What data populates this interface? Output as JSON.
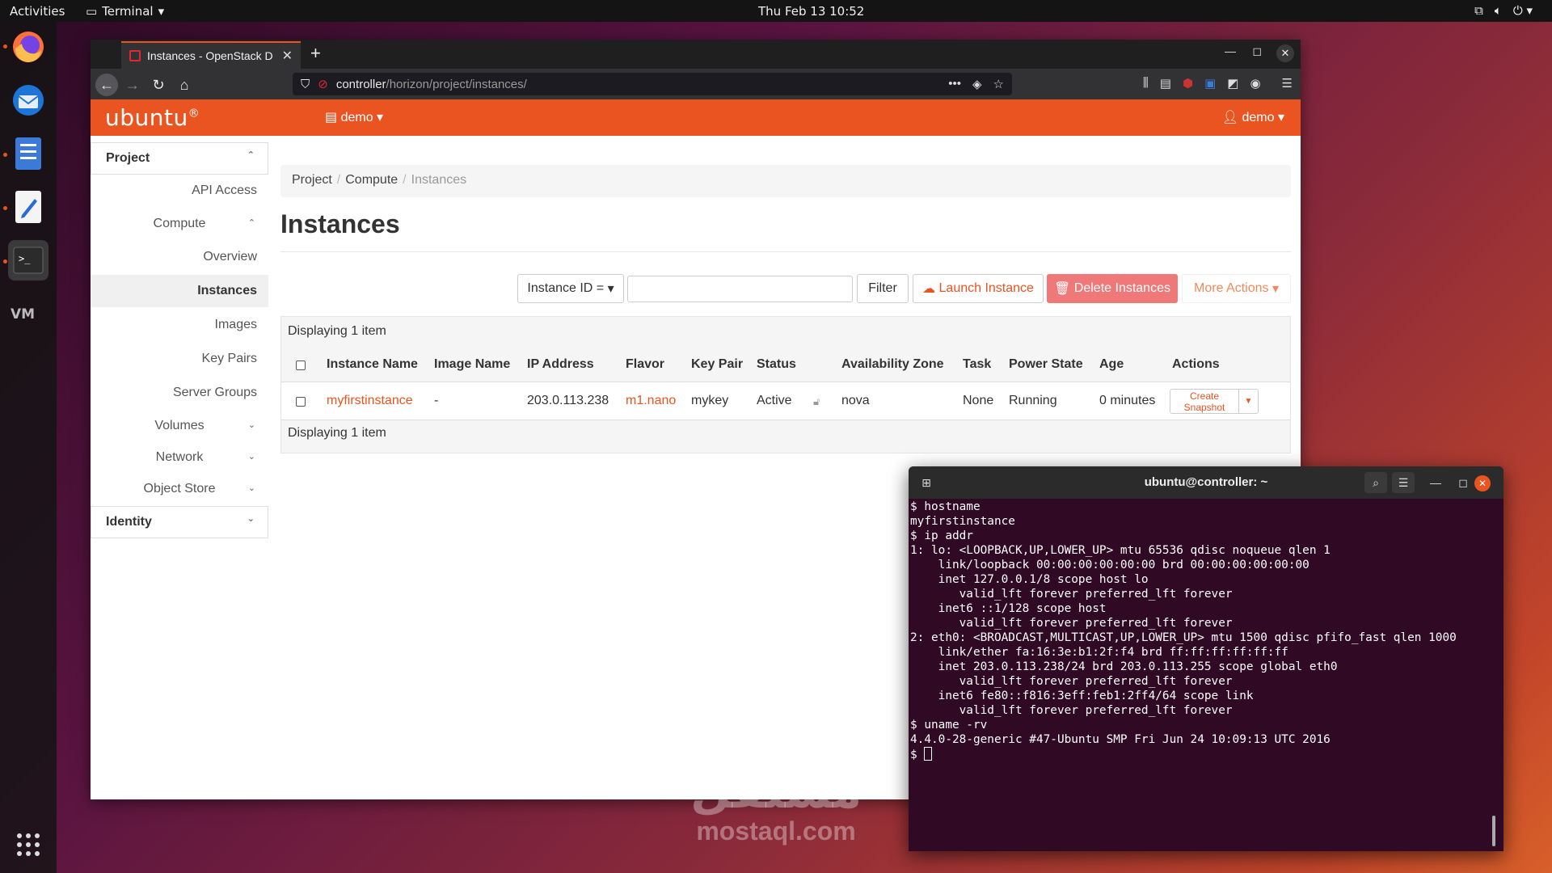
{
  "topbar": {
    "activities": "Activities",
    "app_name": "Terminal",
    "clock": "Thu Feb 13  10:52"
  },
  "dock": {
    "items": [
      "firefox-icon",
      "thunderbird-icon",
      "files-icon",
      "text-editor-icon",
      "terminal-icon",
      "vm-icon"
    ],
    "show_apps": "app-grid-icon"
  },
  "browser": {
    "tab_title": "Instances - OpenStack D",
    "url_host": "controller",
    "url_path": "/horizon/project/instances/"
  },
  "horizon": {
    "logo": "ubuntu",
    "project_menu": "demo",
    "user_menu": "demo",
    "sidebar": {
      "project": "Project",
      "api_access": "API Access",
      "compute": "Compute",
      "overview": "Overview",
      "instances": "Instances",
      "images": "Images",
      "key_pairs": "Key Pairs",
      "server_groups": "Server Groups",
      "volumes": "Volumes",
      "network": "Network",
      "object_store": "Object Store",
      "identity": "Identity"
    },
    "breadcrumb": [
      "Project",
      "Compute",
      "Instances"
    ],
    "page_title": "Instances",
    "actions": {
      "filter_select": "Instance ID =",
      "filter_value": "",
      "filter": "Filter",
      "launch": "Launch Instance",
      "delete": "Delete Instances",
      "more": "More Actions"
    },
    "table": {
      "displaying_top": "Displaying 1 item",
      "displaying_bottom": "Displaying 1 item",
      "headers": [
        "Instance Name",
        "Image Name",
        "IP Address",
        "Flavor",
        "Key Pair",
        "Status",
        "Availability Zone",
        "Task",
        "Power State",
        "Age",
        "Actions"
      ],
      "rows": [
        {
          "instance_name": "myfirstinstance",
          "image_name": "-",
          "ip_address": "203.0.113.238",
          "flavor": "m1.nano",
          "key_pair": "mykey",
          "status": "Active",
          "availability_zone": "nova",
          "task": "None",
          "power_state": "Running",
          "age": "0 minutes",
          "action": "Create Snapshot"
        }
      ]
    }
  },
  "terminal": {
    "title": "ubuntu@controller: ~",
    "lines": [
      "$ hostname",
      "myfirstinstance",
      "$ ip addr",
      "1: lo: <LOOPBACK,UP,LOWER_UP> mtu 65536 qdisc noqueue qlen 1",
      "    link/loopback 00:00:00:00:00:00 brd 00:00:00:00:00:00",
      "    inet 127.0.0.1/8 scope host lo",
      "       valid_lft forever preferred_lft forever",
      "    inet6 ::1/128 scope host",
      "       valid_lft forever preferred_lft forever",
      "2: eth0: <BROADCAST,MULTICAST,UP,LOWER_UP> mtu 1500 qdisc pfifo_fast qlen 1000",
      "    link/ether fa:16:3e:b1:2f:f4 brd ff:ff:ff:ff:ff:ff",
      "    inet 203.0.113.238/24 brd 203.0.113.255 scope global eth0",
      "       valid_lft forever preferred_lft forever",
      "    inet6 fe80::f816:3eff:feb1:2ff4/64 scope link",
      "       valid_lft forever preferred_lft forever",
      "$ uname -rv",
      "4.4.0-28-generic #47-Ubuntu SMP Fri Jun 24 10:09:13 UTC 2016"
    ],
    "prompt": "$ "
  },
  "watermark": {
    "arabic": "مستقل",
    "latin": "mostaql.com"
  },
  "colors": {
    "accent": "#e95420",
    "terminal_bg": "#300a24",
    "danger": "#ef7878"
  }
}
